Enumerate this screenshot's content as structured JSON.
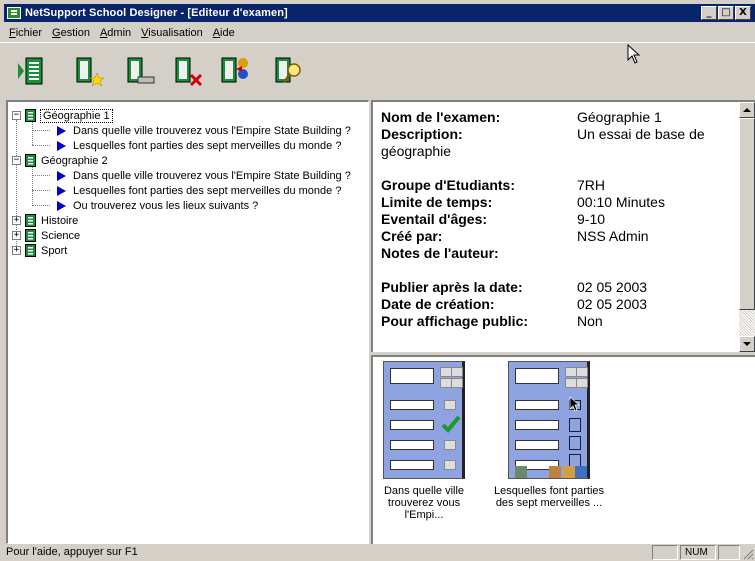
{
  "window": {
    "title": "NetSupport School Designer - [Editeur d'examen]",
    "buttons": [
      "_",
      "□",
      "X"
    ]
  },
  "menu": [
    {
      "first": "F",
      "rest": "ichier"
    },
    {
      "first": "G",
      "rest": "estion"
    },
    {
      "first": "A",
      "rest": "dmin"
    },
    {
      "first": "V",
      "rest": "isualisation"
    },
    {
      "first": "A",
      "rest": "ide"
    }
  ],
  "toolbar": {
    "icons": [
      "exam-list-icon",
      "new-exam-icon",
      "edit-exam-icon",
      "delete-exam-icon",
      "add-question-icon",
      "search-icon"
    ]
  },
  "tree": {
    "nodes": [
      {
        "label": "Géographie 1",
        "expander": "−"
      },
      {
        "label": "Dans quelle ville trouverez vous l'Empire State Building ?"
      },
      {
        "label": "Lesquelles font parties des sept merveilles du monde ?"
      },
      {
        "label": "Géographie 2",
        "expander": "−"
      },
      {
        "label": "Dans quelle ville trouverez vous l'Empire State Building ?"
      },
      {
        "label": "Lesquelles font parties des sept merveilles du monde ?"
      },
      {
        "label": "Ou trouverez vous les lieux suivants  ?"
      },
      {
        "label": "Histoire",
        "expander": "+"
      },
      {
        "label": "Science",
        "expander": "+"
      },
      {
        "label": "Sport",
        "expander": "+"
      }
    ]
  },
  "details": {
    "name_label": "Nom de l'examen:",
    "name_value": "Géographie 1",
    "desc_label": "Description:",
    "desc_value_1": "Un essai de base de",
    "desc_value_2": "géographie",
    "group_label": "Groupe d'Etudiants:",
    "group_value": "7RH",
    "time_label": "Limite de temps:",
    "time_value": "00:10 Minutes",
    "age_label": "Eventail d'âges:",
    "age_value": "9-10",
    "created_by_label": "Créé par:",
    "created_by_value": "NSS Admin",
    "notes_label": "Notes de l'auteur:",
    "publish_label": "Publier après la date:",
    "publish_value": "02 05 2003",
    "creation_label": "Date de création:",
    "creation_value": "02 05 2003",
    "public_label": "Pour affichage public:",
    "public_value": "Non"
  },
  "thumbnails": [
    {
      "line1": "Dans quelle ville",
      "line2": "trouverez vous l'Empi..."
    },
    {
      "line1": "Lesquelles font parties",
      "line2": "des sept merveilles ..."
    }
  ],
  "status": {
    "help": "Pour l'aide, appuyer sur F1",
    "num": "NUM"
  },
  "colors": {
    "titlebar": "#0a246a",
    "thumb_bg": "#8ea3e0",
    "arrow": "#0000c8",
    "book": "#1a8f3a"
  }
}
